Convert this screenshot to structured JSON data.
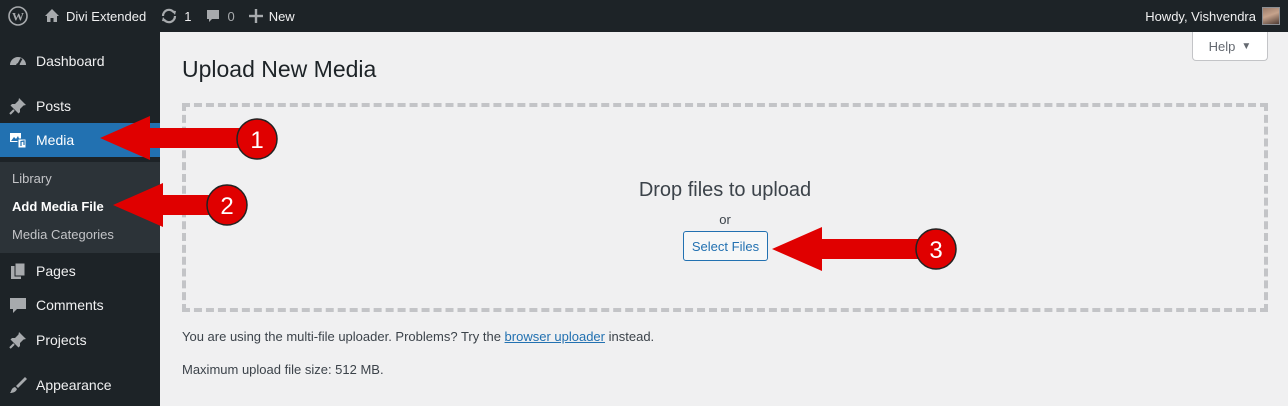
{
  "admin_bar": {
    "site_name": "Divi Extended",
    "updates_count": "1",
    "comments_count": "0",
    "new_label": "New",
    "greeting": "Howdy, Vishvendra"
  },
  "sidebar": {
    "items": [
      {
        "label": "Dashboard",
        "icon": "dashboard-icon"
      },
      {
        "label": "Posts",
        "icon": "pin-icon"
      },
      {
        "label": "Media",
        "icon": "media-icon"
      },
      {
        "label": "Pages",
        "icon": "pages-icon"
      },
      {
        "label": "Comments",
        "icon": "comment-icon"
      },
      {
        "label": "Projects",
        "icon": "pin-icon"
      },
      {
        "label": "Appearance",
        "icon": "brush-icon"
      }
    ],
    "submenu": [
      "Library",
      "Add Media File",
      "Media Categories"
    ]
  },
  "help_label": "Help",
  "page_title": "Upload New Media",
  "dropzone": {
    "title": "Drop files to upload",
    "or": "or",
    "button": "Select Files"
  },
  "uploader_note": {
    "before": "You are using the multi-file uploader. Problems? Try the",
    "link": "browser uploader",
    "after": "instead."
  },
  "max_size": "Maximum upload file size: 512 MB.",
  "annotations": [
    "1",
    "2",
    "3"
  ],
  "colors": {
    "admin_dark": "#1d2327",
    "accent": "#2271b1",
    "annotation_red": "#e00000"
  }
}
